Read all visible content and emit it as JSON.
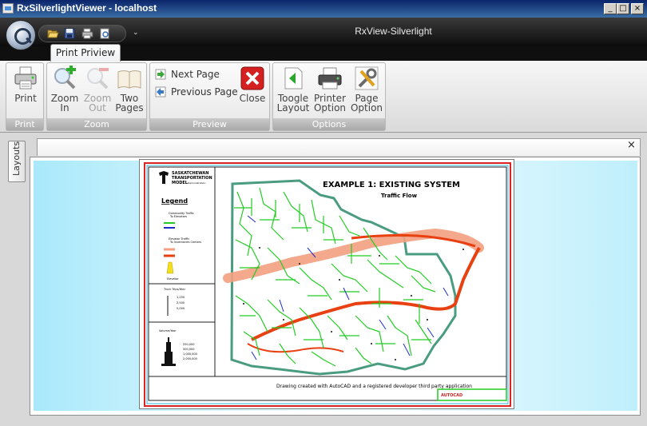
{
  "window": {
    "title": "RxSilverlightViewer - localhost",
    "minimize": "_",
    "maximize": "□",
    "close": "×"
  },
  "app": {
    "title": "RxView-Silverlight",
    "qat_chevron": "⌄"
  },
  "ribbon": {
    "active_tab": "Print Priview",
    "groups": {
      "print": {
        "label": "Print",
        "print_button": "Print"
      },
      "zoom": {
        "label": "Zoom",
        "zoom_in": [
          "Zoom",
          "In"
        ],
        "zoom_out": [
          "Zoom",
          "Out"
        ],
        "two_pages": [
          "Two",
          "Pages"
        ]
      },
      "preview": {
        "label": "Preview",
        "next_page": "Next Page",
        "previous_page": "Previous Page",
        "close": "Close"
      },
      "options": {
        "label": "Options",
        "toogle_layout": [
          "Toogle",
          "Layout"
        ],
        "printer_option": [
          "Printer",
          "Option"
        ],
        "page_option": [
          "Page",
          "Option"
        ]
      }
    }
  },
  "sidebar": {
    "layouts_tab": "Layouts"
  },
  "document": {
    "close": "×"
  },
  "drawing": {
    "title": "EXAMPLE 1: EXISTING SYSTEM",
    "subtitle": "Traffic Flow",
    "org": [
      "SASKATCHEWAN",
      "TRANSPORTATION",
      "MODEL"
    ],
    "org_sub": "Demonstration",
    "legend_title": "Legend",
    "legend_commodity": [
      "Commodity Traffic",
      "To Elevators"
    ],
    "legend_elevator": [
      "Elevator Traffic",
      "To Inventories Centers"
    ],
    "elevator_label": "Elevator",
    "truck_label": "Truck Trips/Year",
    "truck_values": [
      "1,250",
      "2,500",
      "5,000"
    ],
    "volume_label": "Volume/Year",
    "volume_values": [
      "250,000",
      "500,000",
      "1,000,000",
      "2,000,000"
    ],
    "footer": "Drawing created with AutoCAD and a registered developer third party application",
    "stamp": "AUTOCAD"
  },
  "colors": {
    "ribbon_header": "#0c0c0c",
    "commodity_green": "#22cc22",
    "commodity_blue": "#1a2cc8",
    "elevator_salmon": "#f4a080",
    "elevator_red": "#e84010",
    "border_red": "#dd2222",
    "border_teal": "#4a9c80"
  }
}
